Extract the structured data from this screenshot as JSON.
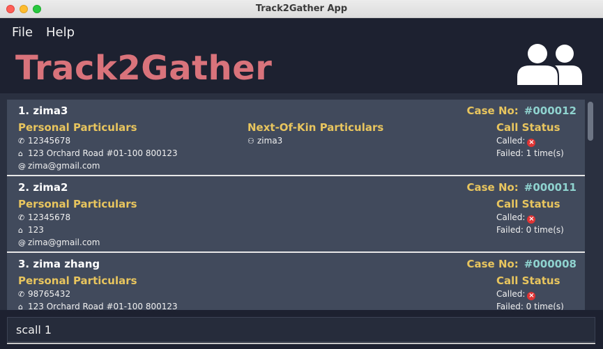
{
  "window": {
    "title": "Track2Gather App"
  },
  "menu": {
    "file": "File",
    "help": "Help"
  },
  "header": {
    "title": "Track2Gather",
    "icon": "people-icon"
  },
  "labels": {
    "case": "Case No:",
    "personal": "Personal Particulars",
    "nok": "Next-Of-Kin Particulars",
    "call_status": "Call Status",
    "called": "Called:"
  },
  "persons": [
    {
      "name": "1.  zima3",
      "case_no": "#000012",
      "phone": "12345678",
      "address": "123 Orchard Road #01-100 800123",
      "email": "zima@gmail.com",
      "nok": "zima3",
      "called": false,
      "failed": "Failed: 1 time(s)"
    },
    {
      "name": "2.  zima2",
      "case_no": "#000011",
      "phone": "12345678",
      "address": "123",
      "email": "zima@gmail.com",
      "called": false,
      "failed": "Failed: 0 time(s)"
    },
    {
      "name": "3.  zima zhang",
      "case_no": "#000008",
      "phone": "98765432",
      "address": "123 Orchard Road #01-100 800123",
      "called": false,
      "failed": "Failed: 0 time(s)"
    }
  ],
  "command": {
    "value": "scall 1"
  },
  "colors": {
    "background": "#1d2130",
    "card": "#414a5c",
    "title": "#d9737b",
    "section": "#e8c55e",
    "case_no": "#8fd3cf",
    "not_called": "#e03434"
  }
}
